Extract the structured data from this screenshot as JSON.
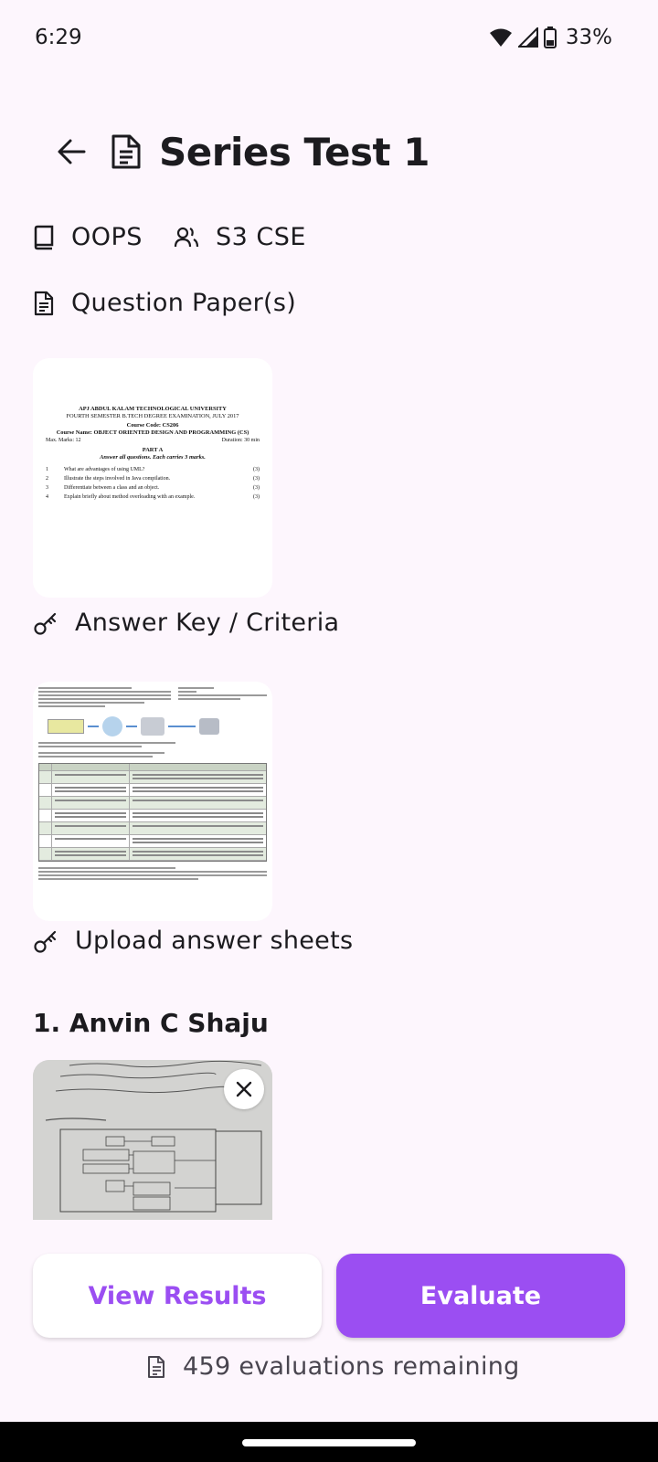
{
  "status_bar": {
    "time": "6:29",
    "battery": "33%",
    "icons": [
      "wifi-icon",
      "signal-icon",
      "battery-icon"
    ]
  },
  "header": {
    "back_icon": "arrow-left-icon",
    "title_icon": "document-icon",
    "title": "Series Test 1"
  },
  "meta": {
    "subject_icon": "book-icon",
    "subject": "OOPS",
    "class_icon": "users-icon",
    "class_name": "S3 CSE"
  },
  "sections": {
    "question_papers": "Question Paper(s)",
    "answer_key": "Answer Key / Criteria",
    "upload": "Upload answer sheets"
  },
  "question_paper": {
    "university": "APJ ABDUL KALAM TECHNOLOGICAL UNIVERSITY",
    "exam": "FOURTH SEMESTER B.TECH DEGREE EXAMINATION, JULY 2017",
    "course_code": "Course Code: CS206",
    "course_name": "Course Name: OBJECT ORIENTED DESIGN AND PROGRAMMING (CS)",
    "max_marks": "Max. Marks: 12",
    "duration": "Duration: 30 min",
    "part": "PART A",
    "instruction": "Answer all questions. Each carries 3 marks.",
    "questions": [
      {
        "n": "1",
        "text": "What are advantages of using UML?",
        "marks": "(3)"
      },
      {
        "n": "2",
        "text": "Illustrate the steps involved in Java compilation.",
        "marks": "(3)"
      },
      {
        "n": "3",
        "text": "Differentiate between a class and an object.",
        "marks": "(3)"
      },
      {
        "n": "4",
        "text": "Explain briefly about method overloading with an example.",
        "marks": "(3)"
      }
    ]
  },
  "students": [
    {
      "name": "1. Anvin C Shaju",
      "remove_icon": "close-icon"
    }
  ],
  "actions": {
    "view_results": "View Results",
    "evaluate": "Evaluate"
  },
  "footer": {
    "icon": "document-icon",
    "remaining": "459 evaluations remaining"
  },
  "colors": {
    "background": "#fdf6fd",
    "accent": "#9b4ef2",
    "text": "#1c1b1f"
  }
}
